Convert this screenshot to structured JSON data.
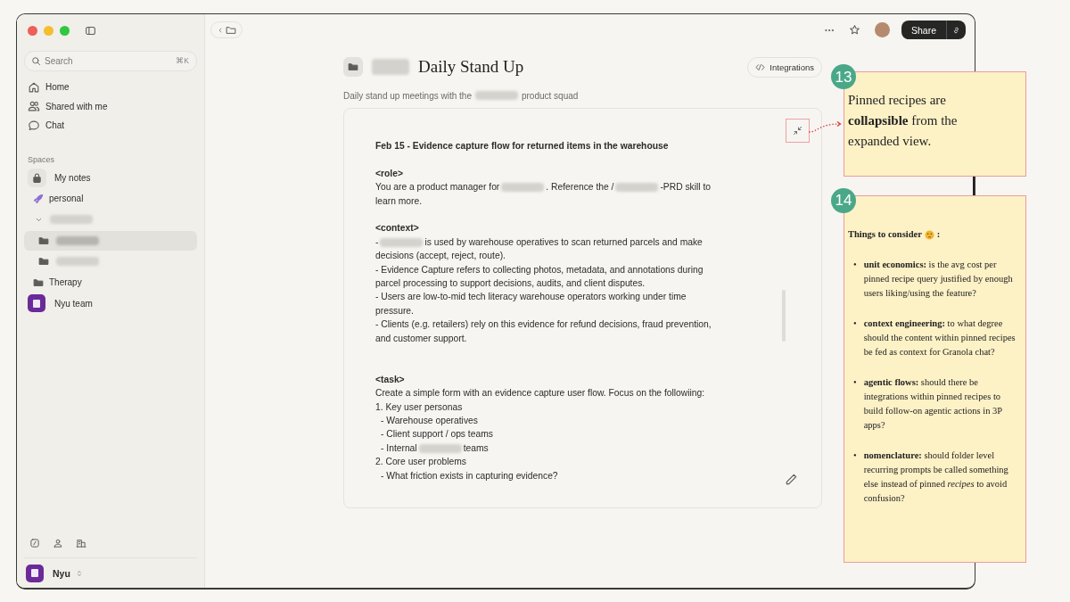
{
  "sidebar": {
    "search": {
      "placeholder": "Search",
      "shortcut": "⌘K"
    },
    "nav": [
      {
        "kind": "home",
        "label": "Home"
      },
      {
        "kind": "shared",
        "label": "Shared with me"
      },
      {
        "kind": "chat",
        "label": "Chat"
      }
    ],
    "spaces_label": "Spaces",
    "spaces": [
      {
        "kind": "lock",
        "label": "My notes",
        "selected": false
      },
      {
        "kind": "rocket",
        "label": "personal",
        "selected": false
      },
      {
        "kind": "group",
        "expanded": true,
        "selected": false,
        "children": [
          {
            "kind": "folder",
            "selected": true
          },
          {
            "kind": "folder",
            "selected": false
          }
        ]
      },
      {
        "kind": "folder",
        "label": "Therapy",
        "selected": false
      },
      {
        "kind": "team",
        "label": "Nyu team",
        "selected": false
      }
    ],
    "workspace": "Nyu"
  },
  "toolbar": {
    "share": "Share"
  },
  "doc": {
    "title": [
      {
        "kind": "redacted"
      },
      {
        "kind": "text",
        "text": "Daily Stand Up"
      }
    ],
    "subtitle": [
      {
        "kind": "text",
        "text": "Daily stand up meetings with the"
      },
      {
        "kind": "redacted"
      },
      {
        "kind": "text",
        "text": "product squad"
      }
    ],
    "integrations": "Integrations",
    "lines": [
      {
        "kind": "bold",
        "parts": [
          {
            "kind": "text",
            "text": "Feb 15 -  Evidence capture flow for returned items in the warehouse"
          }
        ]
      },
      {
        "kind": "blank"
      },
      {
        "kind": "tag",
        "parts": [
          {
            "kind": "text",
            "text": "<role>"
          }
        ]
      },
      {
        "kind": "text",
        "parts": [
          {
            "kind": "text",
            "text": "You are a product manager for"
          },
          {
            "kind": "redacted"
          },
          {
            "kind": "text",
            "text": ". Reference the /"
          },
          {
            "kind": "redacted"
          },
          {
            "kind": "text",
            "text": "-PRD skill to"
          }
        ]
      },
      {
        "kind": "text",
        "parts": [
          {
            "kind": "text",
            "text": "learn more."
          }
        ]
      },
      {
        "kind": "blank"
      },
      {
        "kind": "tag",
        "parts": [
          {
            "kind": "text",
            "text": "<context>"
          }
        ]
      },
      {
        "kind": "text",
        "parts": [
          {
            "kind": "text",
            "text": "-"
          },
          {
            "kind": "redacted"
          },
          {
            "kind": "text",
            "text": "is used by warehouse operatives to scan returned parcels and make"
          }
        ]
      },
      {
        "kind": "text",
        "parts": [
          {
            "kind": "text",
            "text": "decisions (accept, reject, route)."
          }
        ]
      },
      {
        "kind": "text",
        "parts": [
          {
            "kind": "text",
            "text": "- Evidence Capture refers to collecting photos, metadata, and annotations during parcel processing to support decisions, audits, and client disputes."
          }
        ]
      },
      {
        "kind": "text",
        "parts": [
          {
            "kind": "text",
            "text": "- Users are low-to-mid tech literacy warehouse operators working under time pressure."
          }
        ]
      },
      {
        "kind": "text",
        "parts": [
          {
            "kind": "text",
            "text": "- Clients (e.g. retailers) rely on this evidence for refund decisions, fraud prevention, and customer support."
          }
        ]
      },
      {
        "kind": "blank"
      },
      {
        "kind": "blank"
      },
      {
        "kind": "tag",
        "parts": [
          {
            "kind": "text",
            "text": "<task>"
          }
        ]
      },
      {
        "kind": "text",
        "parts": [
          {
            "kind": "text",
            "text": "Create a simple form with an evidence capture user flow. Focus on the followiing:"
          }
        ]
      },
      {
        "kind": "text",
        "parts": [
          {
            "kind": "text",
            "text": "1. Key user personas"
          }
        ]
      },
      {
        "kind": "sub",
        "parts": [
          {
            "kind": "text",
            "text": "- Warehouse operatives"
          }
        ]
      },
      {
        "kind": "sub",
        "parts": [
          {
            "kind": "text",
            "text": "- Client support / ops teams"
          }
        ]
      },
      {
        "kind": "sub",
        "parts": [
          {
            "kind": "text",
            "text": "- Internal"
          },
          {
            "kind": "redacted"
          },
          {
            "kind": "text",
            "text": "teams"
          }
        ]
      },
      {
        "kind": "text",
        "parts": [
          {
            "kind": "text",
            "text": "2. Core user problems"
          }
        ]
      },
      {
        "kind": "sub",
        "parts": [
          {
            "kind": "text",
            "text": "- What friction exists in capturing evidence?"
          }
        ]
      }
    ]
  },
  "annotations": [
    {
      "number": "13",
      "text": "Pinned recipes are **collapsible** from the expanded view."
    },
    {
      "number": "14",
      "heading": "Things to consider",
      "heading_end": ":",
      "bullets": [
        {
          "marker": "•",
          "text": "**unit economics:** is the avg cost per pinned recipe query justified by enough users liking/using the feature?"
        },
        {
          "marker": "•",
          "text": "**context engineering:** to what degree should the content within pinned recipes be fed as context for Granola chat?"
        },
        {
          "marker": "•",
          "text": "**agentic flows:** should there be integrations within pinned recipes to build follow-on agentic actions in 3P apps?"
        },
        {
          "marker": "•",
          "text": "**nomenclature:** should folder level recurring prompts be called something else instead of pinned *recipes* to avoid confusion?"
        }
      ]
    }
  ]
}
